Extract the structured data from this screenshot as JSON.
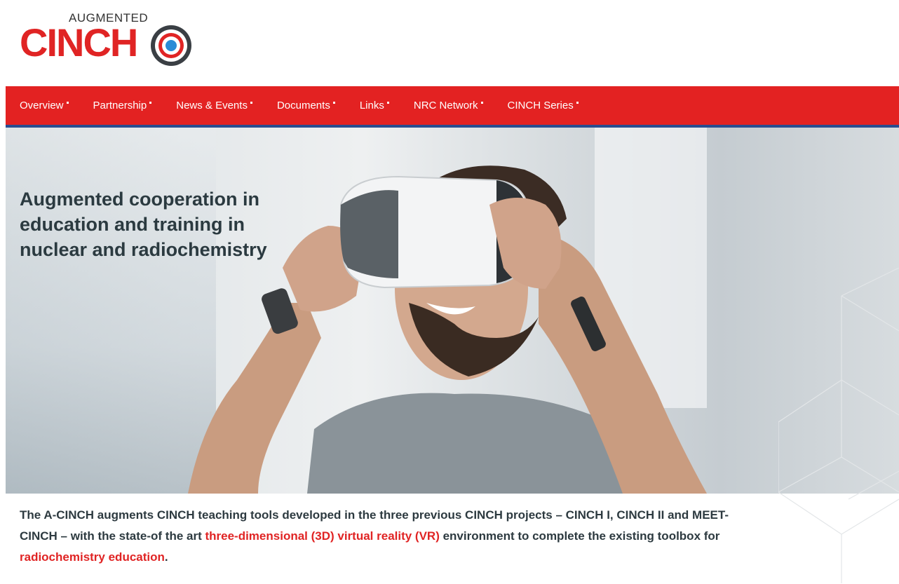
{
  "logo": {
    "augmented": "AUGMENTED",
    "name": "CINCH"
  },
  "nav": {
    "items": [
      {
        "label": "Overview"
      },
      {
        "label": "Partnership"
      },
      {
        "label": "News & Events"
      },
      {
        "label": "Documents"
      },
      {
        "label": "Links"
      },
      {
        "label": "NRC Network"
      },
      {
        "label": "CINCH Series"
      }
    ]
  },
  "hero": {
    "title": "Augmented cooperation in education and training in nuclear and radiochemistry"
  },
  "intro": {
    "part1": "The A-CINCH augments CINCH teaching tools developed in the three previous CINCH projects – CINCH I, CINCH II and MEET-CINCH – with the state-of the art ",
    "link1": "three-dimensional (3D) virtual reality (VR)",
    "part2": " environment to complete the existing toolbox for ",
    "link2": "radiochemistry education",
    "part3": "."
  },
  "colors": {
    "brand_red": "#e32222",
    "nav_underline": "#2a4d8f",
    "text_dark": "#2d3a40"
  }
}
